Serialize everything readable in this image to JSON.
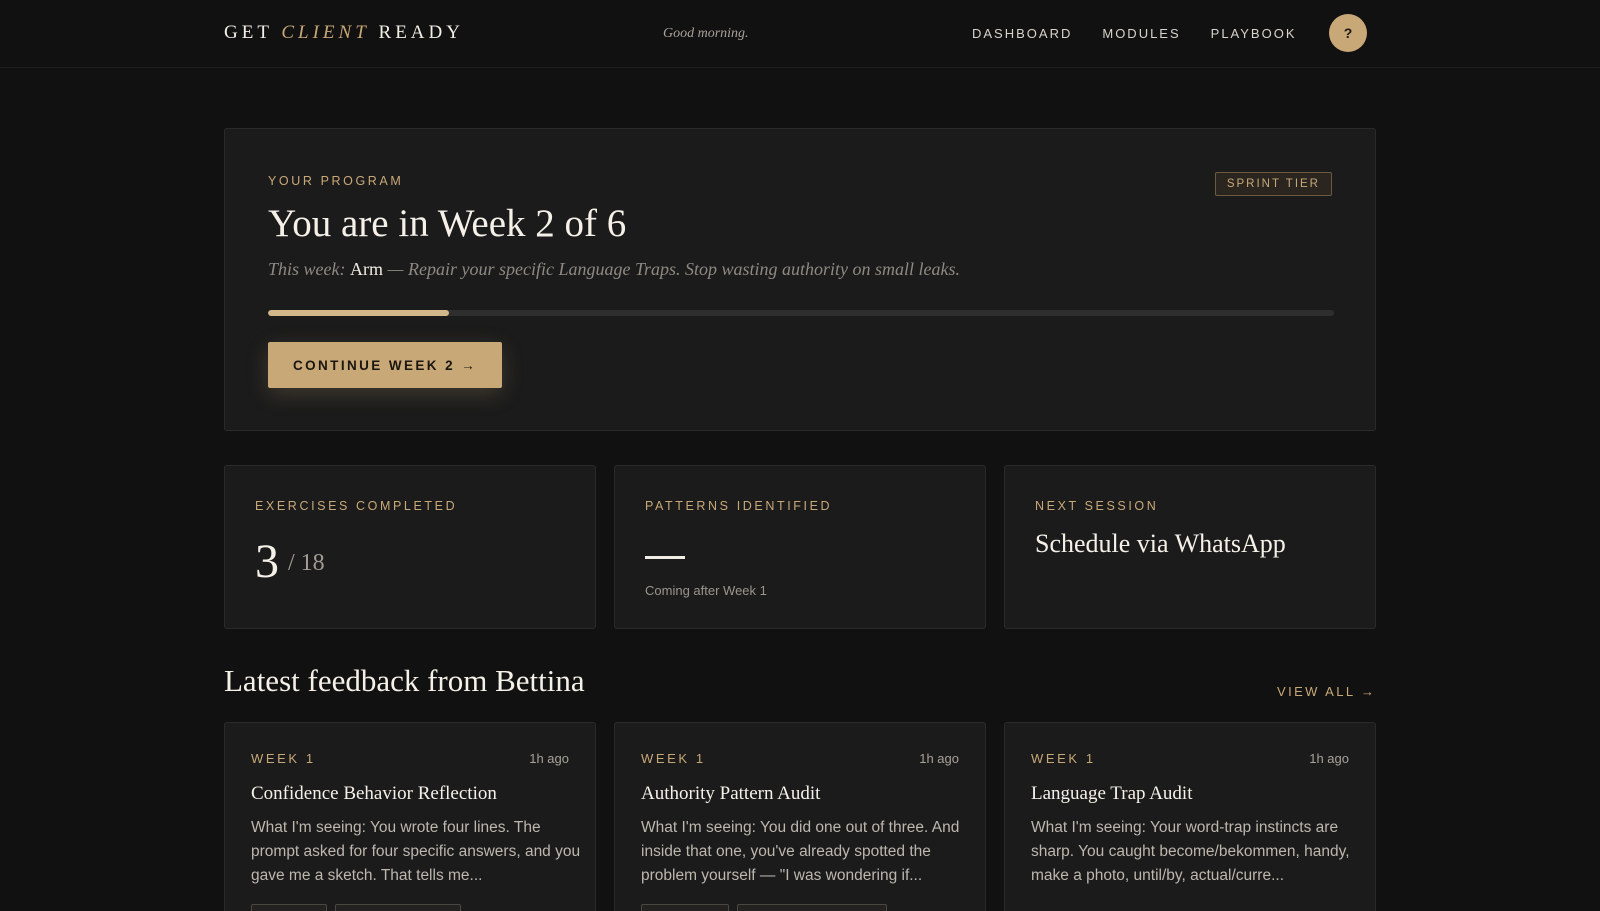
{
  "header": {
    "brand_prefix": "GET ",
    "brand_accent": "CLIENT",
    "brand_suffix": " READY",
    "greeting": "Good morning.",
    "nav": [
      "DASHBOARD",
      "MODULES",
      "PLAYBOOK"
    ],
    "help_label": "?"
  },
  "program": {
    "eyebrow": "YOUR PROGRAM",
    "tier": "SPRINT TIER",
    "title": "You are in Week 2 of 6",
    "this_week_prefix": "This week: ",
    "this_week_highlight": "Arm",
    "this_week_suffix": " — Repair your specific Language Traps. Stop wasting authority on small leaks.",
    "progress_fraction": 0.17,
    "cta": "CONTINUE WEEK 2 →"
  },
  "stats": {
    "exercises": {
      "label": "EXERCISES COMPLETED",
      "value": "3",
      "total": "/ 18"
    },
    "patterns": {
      "label": "PATTERNS IDENTIFIED",
      "note": "Coming after Week 1"
    },
    "session": {
      "label": "NEXT SESSION",
      "value": "Schedule via WhatsApp"
    }
  },
  "feedback": {
    "title": "Latest feedback from Bettina",
    "view_all": "VIEW ALL →",
    "items": [
      {
        "week": "WEEK 1",
        "ago": "1h ago",
        "title": "Confidence Behavior Reflection",
        "excerpt": "What I'm seeing: You wrote four lines. The prompt asked for four specific answers, and you gave me a sketch. That tells me..."
      },
      {
        "week": "WEEK 1",
        "ago": "1h ago",
        "title": "Authority Pattern Audit",
        "excerpt": "What I'm seeing: You did one out of three. And inside that one, you've already spotted the problem yourself — \"I was wondering if..."
      },
      {
        "week": "WEEK 1",
        "ago": "1h ago",
        "title": "Language Trap Audit",
        "excerpt": "What I'm seeing: Your word-trap instincts are sharp. You caught become/bekommen, handy, make a photo, until/by, actual/curre..."
      }
    ]
  },
  "colors": {
    "background": "#111111",
    "card": "#1b1b1b",
    "accent_gold": "#c9a878"
  }
}
